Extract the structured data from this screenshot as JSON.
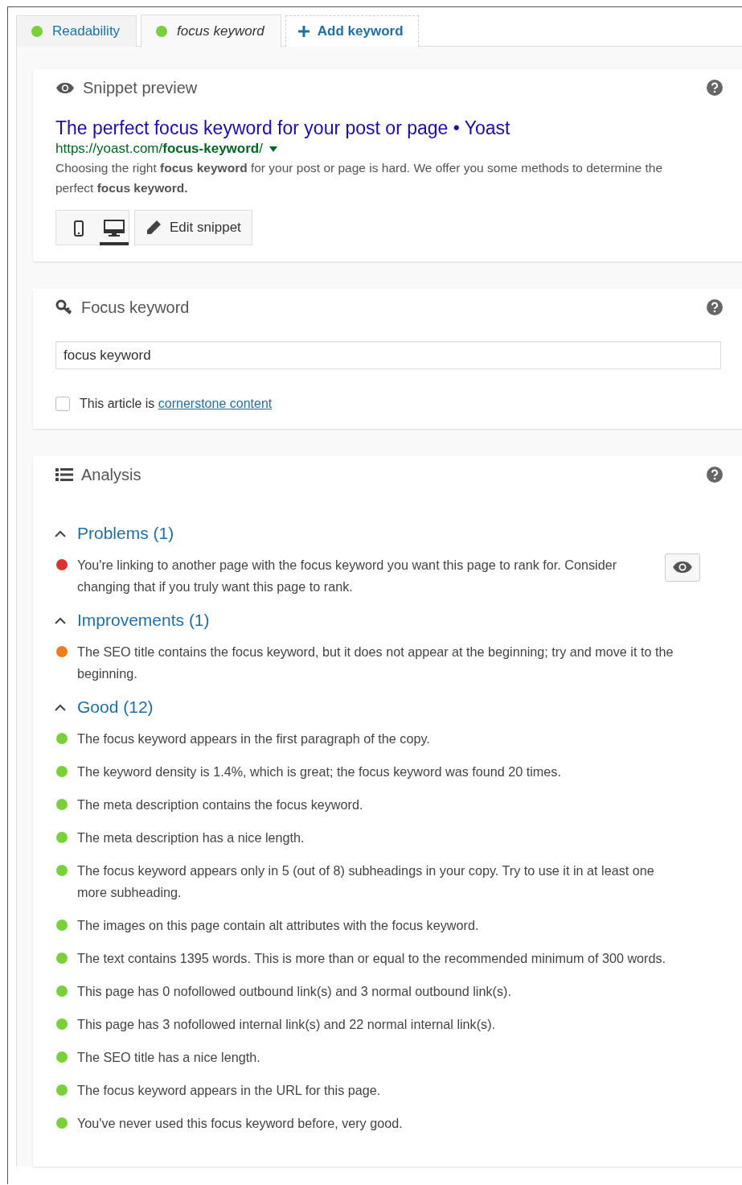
{
  "tabs": [
    {
      "kind": "score",
      "label": "Readability",
      "color": "#7ad03a",
      "selected": false
    },
    {
      "kind": "score",
      "label": "focus keyword",
      "color": "#7ad03a",
      "selected": true
    },
    {
      "kind": "add",
      "label": "Add keyword",
      "selected": false
    }
  ],
  "snippet": {
    "title": "Snippet preview",
    "seo_title": "The perfect focus keyword for your post or page • Yoast",
    "url": "https://yoast.com/**focus-keyword**/",
    "description": "Choosing the right **focus keyword** for your post or page is hard. We offer you some methods to determine the perfect **focus keyword.**",
    "modes": [
      {
        "kind": "mobile",
        "selected": false
      },
      {
        "kind": "desktop",
        "selected": true
      }
    ],
    "edit_button": "Edit snippet"
  },
  "focus_keyword": {
    "title": "Focus keyword",
    "value": "focus keyword",
    "cornerstone": {
      "checked": false,
      "label": "This article is",
      "link": "cornerstone content"
    }
  },
  "analysis": {
    "title": "Analysis",
    "groups": [
      {
        "heading": "Problems (1)",
        "expanded": true,
        "items": [
          {
            "text": "You're linking to another page with the focus keyword you want this page to rank for. Consider changing that if you truly want this page to rank.",
            "color": "#dc3232",
            "marker": true
          }
        ]
      },
      {
        "heading": "Improvements (1)",
        "expanded": true,
        "items": [
          {
            "text": "The SEO title contains the focus keyword, but it does not appear at the beginning; try and move it to the beginning.",
            "color": "#ee7c1b",
            "marker": false
          }
        ]
      },
      {
        "heading": "Good (12)",
        "expanded": true,
        "items": [
          {
            "text": "The focus keyword appears in the first paragraph of the copy.",
            "color": "#7ad03a",
            "marker": false
          },
          {
            "text": "The keyword density is 1.4%, which is great; the focus keyword was found 20 times.",
            "color": "#7ad03a",
            "marker": false
          },
          {
            "text": "The meta description contains the focus keyword.",
            "color": "#7ad03a",
            "marker": false
          },
          {
            "text": "The meta description has a nice length.",
            "color": "#7ad03a",
            "marker": false
          },
          {
            "text": "The focus keyword appears only in 5 (out of 8) subheadings in your copy. Try to use it in at least one more subheading.",
            "color": "#7ad03a",
            "marker": false
          },
          {
            "text": "The images on this page contain alt attributes with the focus keyword.",
            "color": "#7ad03a",
            "marker": false
          },
          {
            "text": "The text contains 1395 words. This is more than or equal to the recommended minimum of 300 words.",
            "color": "#7ad03a",
            "marker": false
          },
          {
            "text": "This page has 0 nofollowed outbound link(s) and 3 normal outbound link(s).",
            "color": "#7ad03a",
            "marker": false
          },
          {
            "text": "This page has 3 nofollowed internal link(s) and 22 normal internal link(s).",
            "color": "#7ad03a",
            "marker": false
          },
          {
            "text": "The SEO title has a nice length.",
            "color": "#7ad03a",
            "marker": false
          },
          {
            "text": "The focus keyword appears in the URL for this page.",
            "color": "#7ad03a",
            "marker": false
          },
          {
            "text": "You've never used this focus keyword before, very good.",
            "color": "#7ad03a",
            "marker": false
          }
        ]
      }
    ]
  }
}
